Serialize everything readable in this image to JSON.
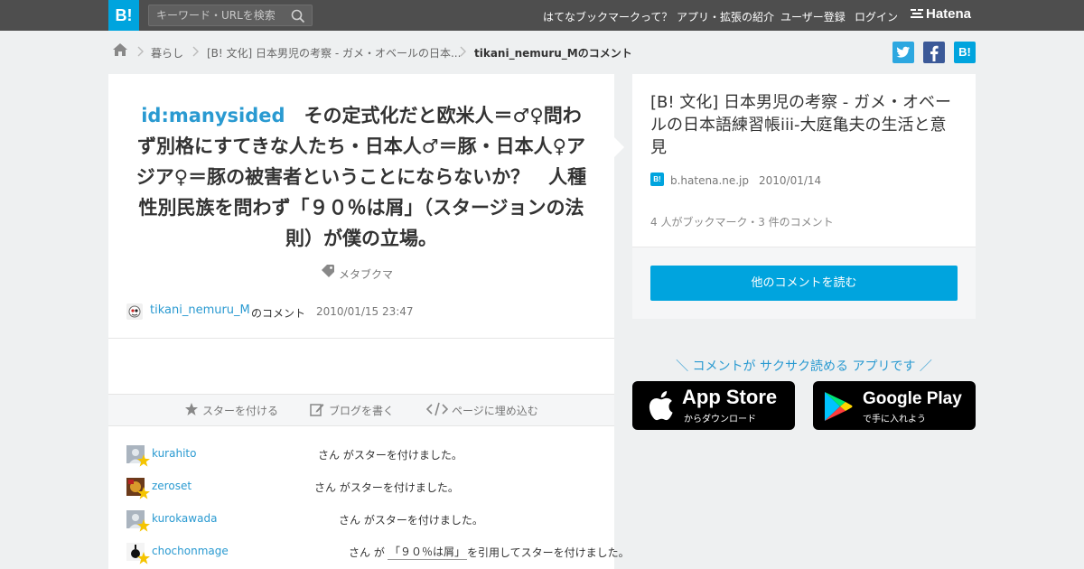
{
  "header": {
    "logo_text": "B!",
    "search_placeholder": "キーワード・URLを検索",
    "nav": [
      "はてなブックマークって？",
      "アプリ・拡張の紹介",
      "ユーザー登録",
      "ログイン"
    ],
    "hatena_label": "Hatena"
  },
  "breadcrumb": {
    "items": [
      "暮らし",
      "[B! 文化] 日本男児の考察 - ガメ・オベールの日本...",
      "tikani_nemuru_Mのコメント"
    ]
  },
  "share": {
    "twitter": "t",
    "facebook": "f",
    "hatena": "B!"
  },
  "comment": {
    "id_link": "id:manysided",
    "body": "　その定式化だと欧米人＝♂♀問わず別格にすてきな人たち・日本人♂＝豚・日本人♀アジア♀＝豚の被害者ということにならないか？　人種性別民族を問わず「９０％は屑」（スタージョンの法則）が僕の立場。",
    "tag": "メタブクマ",
    "author": "tikani_nemuru_M",
    "author_suffix": "のコメント",
    "date": "2010/01/15 23:47"
  },
  "actions": {
    "star": "スターを付ける",
    "blog": "ブログを書く",
    "embed": "ページに埋め込む"
  },
  "stars": [
    {
      "user": "kurahito",
      "text": "さん がスターを付けました。"
    },
    {
      "user": "zeroset",
      "text": "さん がスターを付けました。"
    },
    {
      "user": "kurokawada",
      "text": "さん がスターを付けました。"
    },
    {
      "user": "chochonmage",
      "text_before": "さん が",
      "quote": "「９０％は屑」",
      "text_after": "を引用してスターを付けました。"
    }
  ],
  "entry": {
    "title": "[B! 文化] 日本男児の考察 - ガメ・オベールの日本語練習帳iii-大庭亀夫の生活と意見",
    "favicon": "B!",
    "domain": "b.hatena.ne.jp",
    "date": "2010/01/14",
    "counts": "4 人がブックマーク・3 件のコメント",
    "read_button": "他のコメントを読む"
  },
  "apps": {
    "caption": "＼ コメントが サクサク読める アプリです ／",
    "appstore_main": "App Store",
    "appstore_sub": "からダウンロード",
    "googleplay_main": "Google Play",
    "googleplay_sub": "で手に入れよう"
  },
  "colors": {
    "accent": "#00a4de",
    "link": "#2a9ad1",
    "topbar": "#4e4e4e",
    "star": "#f5c400"
  }
}
